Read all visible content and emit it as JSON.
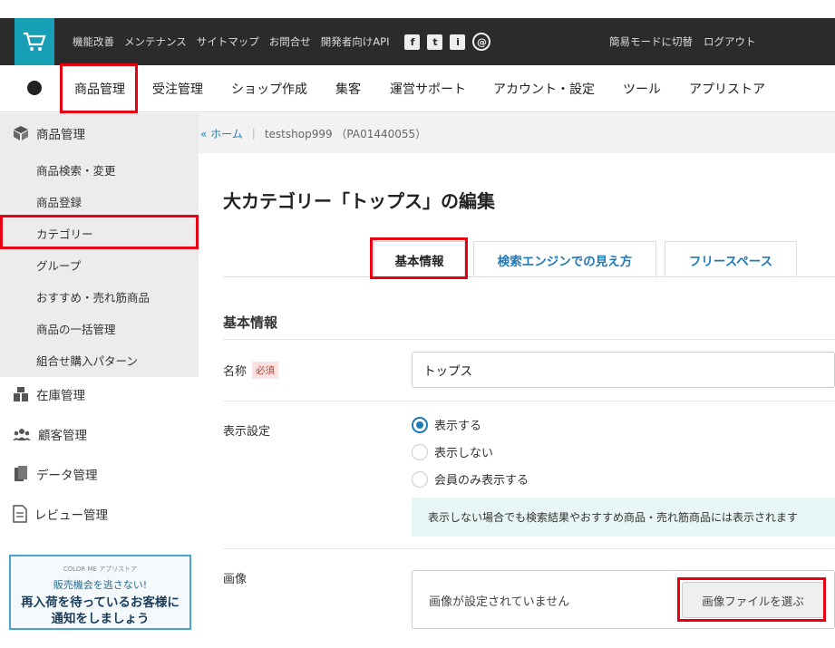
{
  "topbar": {
    "links": [
      "機能改善",
      "メンテナンス",
      "サイトマップ",
      "お問合せ",
      "開発者向けAPI"
    ],
    "social": [
      "f",
      "t",
      "i",
      "@"
    ],
    "right_links": [
      "簡易モードに切替",
      "ログアウト"
    ]
  },
  "mainnav": {
    "items": [
      "商品管理",
      "受注管理",
      "ショップ作成",
      "集客",
      "運営サポート",
      "アカウント・設定",
      "ツール",
      "アプリストア"
    ]
  },
  "sidebar": {
    "heading": "商品管理",
    "sub_items": [
      "商品検索・変更",
      "商品登録",
      "カテゴリー",
      "グループ",
      "おすすめ・売れ筋商品",
      "商品の一括管理",
      "組合せ購入パターン"
    ],
    "groups": [
      "在庫管理",
      "顧客管理",
      "データ管理",
      "レビュー管理"
    ],
    "banner": {
      "small": "COLOR ME アプリストア",
      "line1": "販売機会を逃さない!",
      "line2": "再入荷を待っているお客様に",
      "line3": "通知をしましょう"
    }
  },
  "breadcrumb": {
    "home": "« ホーム",
    "shop": "testshop999 （PA01440055）"
  },
  "page": {
    "title": "大カテゴリー「トップス」の編集",
    "tabs": [
      "基本情報",
      "検索エンジンでの見え方",
      "フリースペース"
    ],
    "section_title": "基本情報",
    "name_label": "名称",
    "required": "必須",
    "name_value": "トップス",
    "display_label": "表示設定",
    "radios": [
      "表示する",
      "表示しない",
      "会員のみ表示する"
    ],
    "note": "表示しない場合でも検索結果やおすすめ商品・売れ筋商品には表示されます",
    "image_label": "画像",
    "image_empty": "画像が設定されていません",
    "file_button": "画像ファイルを選ぶ"
  },
  "colors": {
    "accent": "#1f79b7",
    "highlight": "#e60012",
    "topbar": "#2b2b2b",
    "logo": "#17a0b5"
  }
}
